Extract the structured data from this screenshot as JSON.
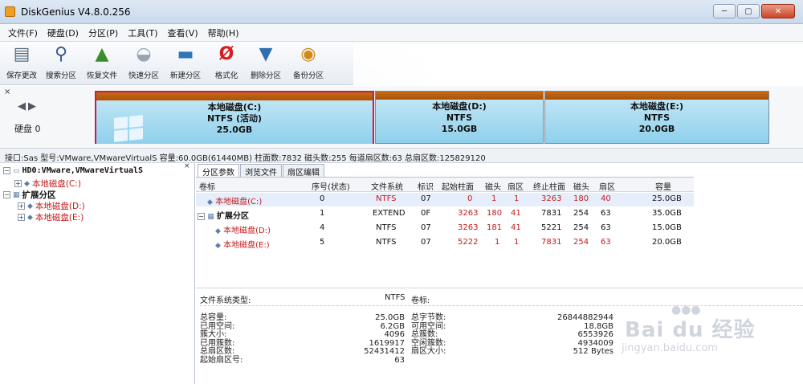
{
  "window": {
    "title": "DiskGenius V4.8.0.256"
  },
  "menu": [
    "文件(F)",
    "硬盘(D)",
    "分区(P)",
    "工具(T)",
    "查看(V)",
    "帮助(H)"
  ],
  "toolbar": [
    {
      "label": "保存更改",
      "icon": "save-icon"
    },
    {
      "label": "搜索分区",
      "icon": "search-icon"
    },
    {
      "label": "恢复文件",
      "icon": "recover-file-icon"
    },
    {
      "label": "快速分区",
      "icon": "quick-partition-icon"
    },
    {
      "label": "新建分区",
      "icon": "new-partition-icon"
    },
    {
      "label": "格式化",
      "icon": "format-icon"
    },
    {
      "label": "删除分区",
      "icon": "delete-partition-icon"
    },
    {
      "label": "备份分区",
      "icon": "backup-partition-icon"
    }
  ],
  "disk_map": {
    "disk_label": "硬盘 0",
    "partitions": [
      {
        "name": "本地磁盘(C:)",
        "fs": "NTFS (活动)",
        "size": "25.0GB",
        "selected": true
      },
      {
        "name": "本地磁盘(D:)",
        "fs": "NTFS",
        "size": "15.0GB",
        "selected": false
      },
      {
        "name": "本地磁盘(E:)",
        "fs": "NTFS",
        "size": "20.0GB",
        "selected": false
      }
    ]
  },
  "info_bar": "接口:Sas  型号:VMware,VMwareVirtualS  容量:60.0GB(61440MB)  柱面数:7832  磁头数:255  每道扇区数:63  总扇区数:125829120",
  "tree": {
    "disk": "HD0:VMware,VMwareVirtualS",
    "items": [
      "本地磁盘(C:)",
      "扩展分区",
      "本地磁盘(D:)",
      "本地磁盘(E:)"
    ]
  },
  "tabs": [
    "分区参数",
    "浏览文件",
    "扇区编辑"
  ],
  "table": {
    "headers": [
      "卷标",
      "序号(状态)",
      "文件系统",
      "标识",
      "起始柱面",
      "磁头",
      "扇区",
      "终止柱面",
      "磁头",
      "扇区",
      "容量"
    ],
    "rows": [
      [
        "本地磁盘(C:)",
        "0",
        "NTFS",
        "07",
        "0",
        "1",
        "1",
        "3263",
        "180",
        "40",
        "25.0GB"
      ],
      [
        "扩展分区",
        "1",
        "EXTEND",
        "0F",
        "3263",
        "180",
        "41",
        "7831",
        "254",
        "63",
        "35.0GB"
      ],
      [
        "本地磁盘(D:)",
        "4",
        "NTFS",
        "07",
        "3263",
        "181",
        "41",
        "5221",
        "254",
        "63",
        "15.0GB"
      ],
      [
        "本地磁盘(E:)",
        "5",
        "NTFS",
        "07",
        "5222",
        "1",
        "1",
        "7831",
        "254",
        "63",
        "20.0GB"
      ]
    ]
  },
  "fs_info": {
    "type_label": "文件系统类型:",
    "type_value": "NTFS",
    "volume_label": "卷标:",
    "left_labels": [
      "总容量:",
      "已用空间:",
      "簇大小:",
      "已用簇数:",
      "总扇区数:",
      "起始扇区号:"
    ],
    "left_values": [
      "25.0GB",
      "6.2GB",
      "4096",
      "1619917",
      "52431412",
      "63"
    ],
    "right_labels": [
      "总字节数:",
      "可用空间:",
      "总簇数:",
      "空闲簇数:",
      "扇区大小:"
    ],
    "right_values": [
      "26844882944",
      "18.8GB",
      "6553926",
      "4934009",
      "512 Bytes"
    ]
  },
  "watermark": {
    "main": "Bai du 经验",
    "sub": "jingyan.baidu.com"
  }
}
